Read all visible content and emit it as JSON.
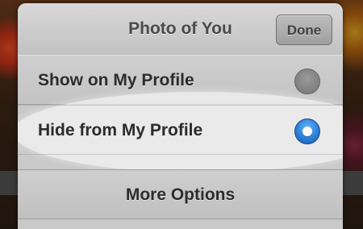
{
  "sheet": {
    "title": "Photo of You",
    "done_label": "Done"
  },
  "options": [
    {
      "label": "Show on My Profile",
      "selected": false,
      "icon": "radio-unselected-icon"
    },
    {
      "label": "Hide from My Profile",
      "selected": true,
      "icon": "radio-selected-icon"
    }
  ],
  "more_options_label": "More Options",
  "colors": {
    "accent": "#2a7fd8",
    "sheet_bg": "#c9c9c9"
  }
}
